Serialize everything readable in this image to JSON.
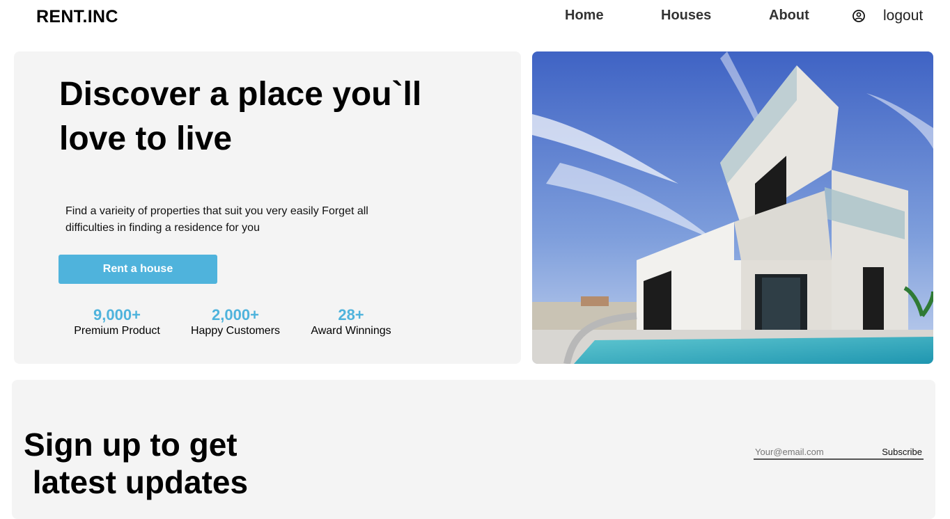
{
  "nav": {
    "logo": "RENT.INC",
    "links": [
      "Home",
      "Houses",
      "About"
    ],
    "user_icon": "user-circle-icon",
    "logout": "logout"
  },
  "hero": {
    "title": "Discover a place you`ll love to live",
    "description": "Find a varieity of properties that suit you very easily Forget all difficulties in finding a residence for you",
    "cta": "Rent a house",
    "stats": [
      {
        "value": "9,000+",
        "label": "Premium Product"
      },
      {
        "value": "2,000+",
        "label": "Happy Customers"
      },
      {
        "value": "28+",
        "label": "Award Winnings"
      }
    ]
  },
  "signup": {
    "title": "Sign up to get\n latest updates",
    "email_placeholder": "Your@email.com",
    "subscribe": "Subscribe"
  },
  "colors": {
    "accent": "#4fb3dc",
    "card_bg": "#f4f4f4"
  }
}
